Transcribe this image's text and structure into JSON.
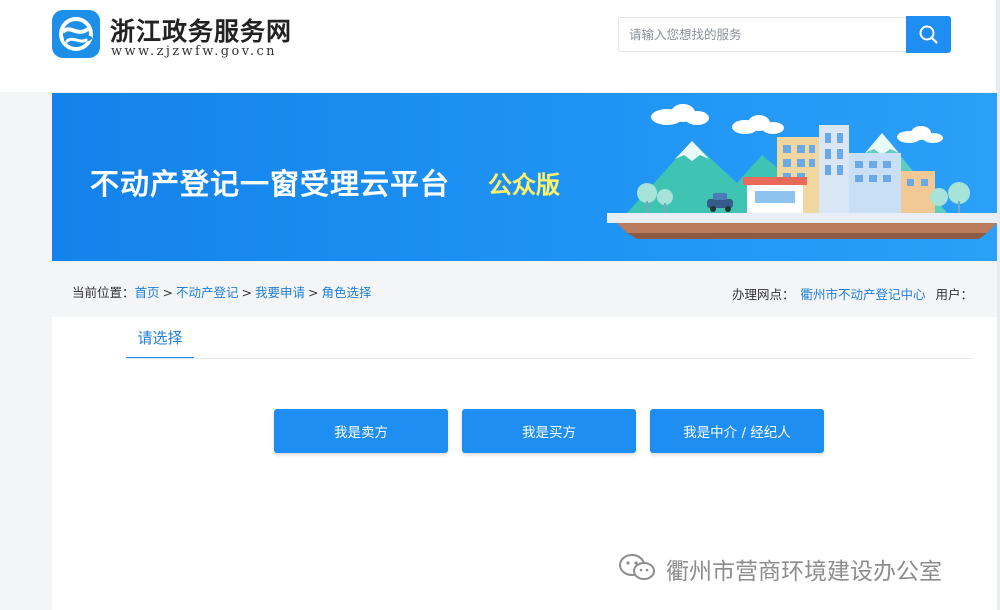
{
  "header": {
    "site_title": "浙江政务服务网",
    "site_url": "www.zjzwfw.gov.cn",
    "search_placeholder": "请输入您想找的服务"
  },
  "banner": {
    "title": "不动产登记一窗受理云平台",
    "edition": "公众版"
  },
  "breadcrumb": {
    "prefix": "当前位置：",
    "items": [
      "首页",
      "不动产登记",
      "我要申请",
      "角色选择"
    ],
    "separator": ">"
  },
  "office": {
    "label": "办理网点：",
    "name": "衢州市不动产登记中心",
    "user_label": "用户："
  },
  "main": {
    "tab_label": "请选择",
    "roles": [
      "我是卖方",
      "我是买方",
      "我是中介 / 经纪人"
    ]
  },
  "watermark": {
    "text": "衢州市营商环境建设办公室",
    "icon": "wechat-icon"
  },
  "colors": {
    "primary": "#1f8ef2",
    "link": "#1f7fd8",
    "banner_edition": "#fff36b"
  }
}
